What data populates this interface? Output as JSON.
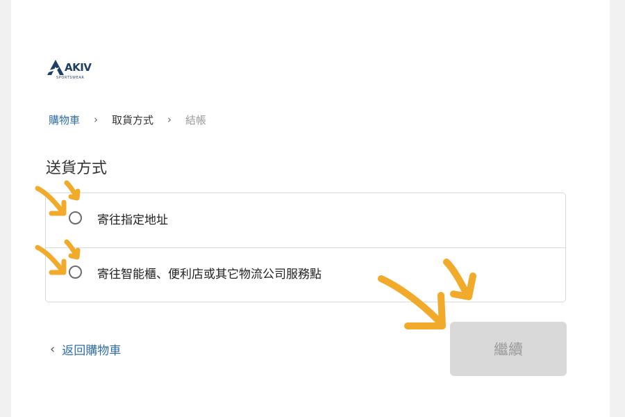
{
  "brand": {
    "name": "AKIV",
    "tagline": "SPORTSWEAR",
    "color": "#1f3f66"
  },
  "breadcrumb": {
    "items": [
      {
        "label": "購物車",
        "state": "link"
      },
      {
        "label": "取貨方式",
        "state": "current"
      },
      {
        "label": "結帳",
        "state": "upcoming"
      }
    ],
    "separator": "›"
  },
  "shipping": {
    "title": "送貨方式",
    "options": [
      {
        "label": "寄往指定地址",
        "selected": false
      },
      {
        "label": "寄往智能櫃、便利店或其它物流公司服務點",
        "selected": false
      }
    ]
  },
  "footer": {
    "back_label": "返回購物車",
    "back_icon": "chevron-left-icon",
    "continue_label": "繼續",
    "continue_disabled": true
  },
  "annotations": {
    "arrow_color": "#f2aa2b"
  }
}
